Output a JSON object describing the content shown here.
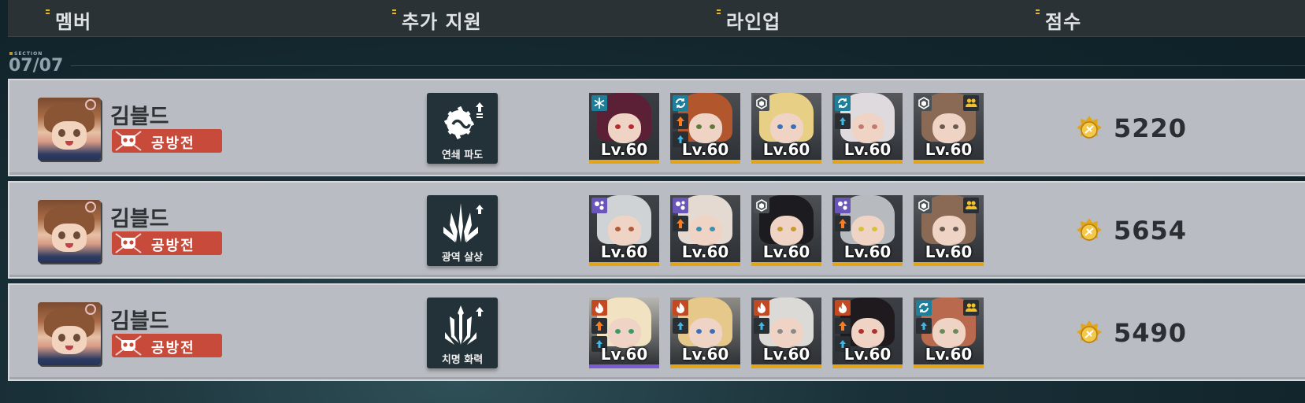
{
  "header": {
    "columns": [
      "멤버",
      "추가 지원",
      "라인업",
      "점수"
    ]
  },
  "section": {
    "tag": "SECTION",
    "counter": "07/07"
  },
  "colors": {
    "badge": "#c84a3b",
    "support_tile": "#223238",
    "row_bg": "#b9bcc2",
    "level_bar_gold": "#e2a51a",
    "level_bar_purple": "#7a5bd0"
  },
  "rows": [
    {
      "player_name": "김블드",
      "mode_badge": "공방전",
      "support": {
        "label": "연쇄 파도",
        "icon": "chain-wave-gear-icon"
      },
      "lineup": [
        {
          "level": "Lv.60",
          "icons": [
            "snowflake-icon"
          ]
        },
        {
          "level": "Lv.60",
          "icons": [
            "cycle-icon",
            "attack-up-icon",
            "speed-up-icon"
          ]
        },
        {
          "level": "Lv.60",
          "icons": [
            "hexagon-shield-icon"
          ]
        },
        {
          "level": "Lv.60",
          "icons": [
            "cycle-icon",
            "speed-up-icon"
          ]
        },
        {
          "level": "Lv.60",
          "icons": [
            "hexagon-shield-icon",
            "friend-support-icon"
          ]
        }
      ],
      "score": "5220"
    },
    {
      "player_name": "김블드",
      "mode_badge": "공방전",
      "support": {
        "label": "광역 살상",
        "icon": "area-kill-spikes-icon"
      },
      "lineup": [
        {
          "level": "Lv.60",
          "icons": [
            "orbs-icon"
          ]
        },
        {
          "level": "Lv.60",
          "icons": [
            "orbs-icon",
            "attack-up-icon"
          ]
        },
        {
          "level": "Lv.60",
          "icons": [
            "hexagon-shield-icon"
          ]
        },
        {
          "level": "Lv.60",
          "icons": [
            "orbs-icon",
            "attack-up-icon"
          ]
        },
        {
          "level": "Lv.60",
          "icons": [
            "hexagon-shield-icon",
            "friend-support-icon"
          ]
        }
      ],
      "score": "5654"
    },
    {
      "player_name": "김블드",
      "mode_badge": "공방전",
      "support": {
        "label": "치명 화력",
        "icon": "critical-fire-trident-icon"
      },
      "lineup": [
        {
          "level": "Lv.60",
          "icons": [
            "fire-icon",
            "attack-up-icon",
            "speed-up-icon"
          ],
          "bar": "purple"
        },
        {
          "level": "Lv.60",
          "icons": [
            "fire-icon",
            "speed-up-icon"
          ]
        },
        {
          "level": "Lv.60",
          "icons": [
            "fire-icon",
            "speed-up-icon"
          ]
        },
        {
          "level": "Lv.60",
          "icons": [
            "fire-icon",
            "attack-up-icon",
            "speed-up-icon"
          ]
        },
        {
          "level": "Lv.60",
          "icons": [
            "cycle-icon",
            "speed-up-icon",
            "friend-support-icon"
          ]
        }
      ],
      "score": "5490"
    }
  ]
}
